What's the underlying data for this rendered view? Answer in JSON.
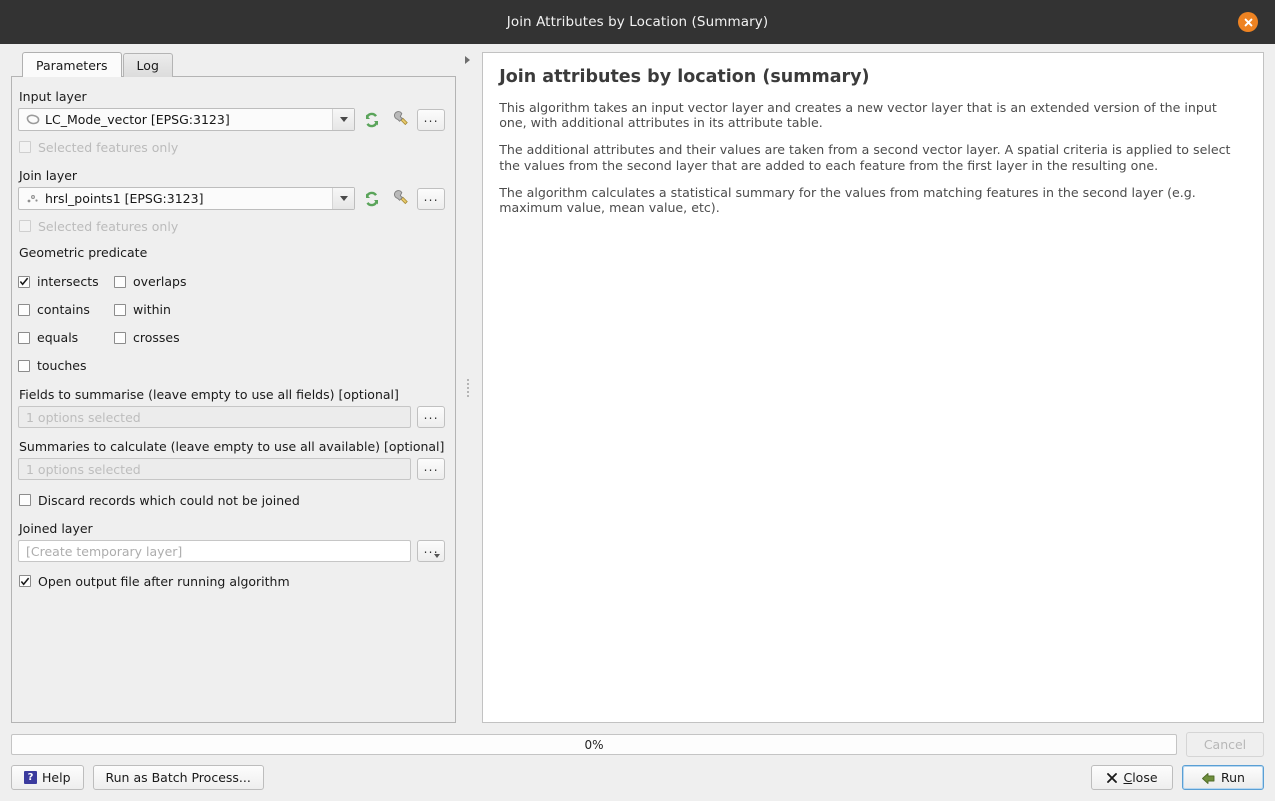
{
  "window": {
    "title": "Join Attributes by Location (Summary)",
    "close_icon": "close-icon",
    "accent_close": "#ee8322"
  },
  "tabs": [
    {
      "label": "Parameters",
      "active": true
    },
    {
      "label": "Log",
      "active": false
    }
  ],
  "parameters": {
    "input_layer": {
      "label": "Input layer",
      "value": "LC_Mode_vector [EPSG:3123]",
      "icon": "polygon-layer-icon",
      "refresh_icon": "refresh-icon",
      "wrench_icon": "wrench-icon",
      "more_label": "...",
      "selected_features_label": "Selected features only",
      "selected_features_checked": false,
      "selected_features_enabled": false
    },
    "join_layer": {
      "label": "Join layer",
      "value": "hrsl_points1 [EPSG:3123]",
      "icon": "point-layer-icon",
      "refresh_icon": "refresh-icon",
      "wrench_icon": "wrench-icon",
      "more_label": "...",
      "selected_features_label": "Selected features only",
      "selected_features_checked": false,
      "selected_features_enabled": false
    },
    "geometric_predicate": {
      "label": "Geometric predicate",
      "options": [
        {
          "label": "intersects",
          "checked": true
        },
        {
          "label": "overlaps",
          "checked": false
        },
        {
          "label": "contains",
          "checked": false
        },
        {
          "label": "within",
          "checked": false
        },
        {
          "label": "equals",
          "checked": false
        },
        {
          "label": "crosses",
          "checked": false
        },
        {
          "label": "touches",
          "checked": false
        }
      ]
    },
    "fields_to_summarise": {
      "label": "Fields to summarise (leave empty to use all fields) [optional]",
      "value": "1 options selected",
      "more_label": "..."
    },
    "summaries_to_calculate": {
      "label": "Summaries to calculate (leave empty to use all available) [optional]",
      "value": "1 options selected",
      "more_label": "..."
    },
    "discard_records": {
      "label": "Discard records which could not be joined",
      "checked": false
    },
    "joined_layer": {
      "label": "Joined layer",
      "value": "[Create temporary layer]",
      "more_label": "..."
    },
    "open_output": {
      "label": "Open output file after running algorithm",
      "checked": true
    }
  },
  "help": {
    "title": "Join attributes by location (summary)",
    "paragraphs": [
      "This algorithm takes an input vector layer and creates a new vector layer that is an extended version of the input one, with additional attributes in its attribute table.",
      "The additional attributes and their values are taken from a second vector layer. A spatial criteria is applied to select the values from the second layer that are added to each feature from the first layer in the resulting one.",
      "The algorithm calculates a statistical summary for the values from matching features in the second layer (e.g. maximum value, mean value, etc)."
    ]
  },
  "footer": {
    "progress_text": "0%",
    "progress_value": 0,
    "cancel_label": "Cancel",
    "cancel_enabled": false,
    "help_label": "Help",
    "batch_label": "Run as Batch Process...",
    "close_label": "Close",
    "run_label": "Run"
  }
}
